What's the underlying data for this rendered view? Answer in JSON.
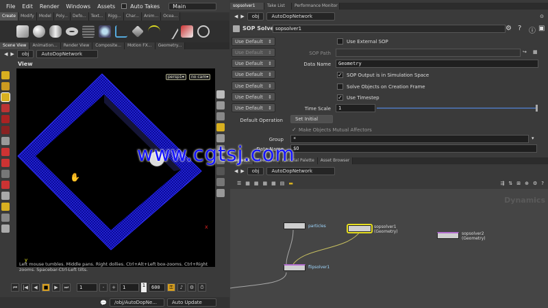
{
  "menu": {
    "items": [
      "File",
      "Edit",
      "Render",
      "Windows",
      "Assets"
    ],
    "auto_takes": "Auto Takes",
    "desktop": "Main"
  },
  "shelf_tabs": [
    "Create",
    "Modify",
    "Model",
    "Poly...",
    "Defo...",
    "Text...",
    "Rigg...",
    "Char...",
    "Anim...",
    "Ocea..."
  ],
  "left_tabs": [
    "Scene View",
    "Animation...",
    "Render View",
    "Composite...",
    "Motion FX...",
    "Geometry..."
  ],
  "left_path": {
    "context": "obj",
    "network": "AutoDopNetwork"
  },
  "viewport": {
    "title": "View",
    "camera": "persp1▾",
    "cam_menu": "no cam▾",
    "axis": "y",
    "status_line": "Left mouse tumbles. Middle pans. Right dollies. Ctrl+Alt+Left box-zooms. Ctrl+Right zooms. Spacebar-Ctrl-Left tilts."
  },
  "playbar": {
    "frame": "1",
    "start": "1",
    "current": "1",
    "end": "600",
    "plus": "+",
    "minus": "-"
  },
  "bottom": {
    "path": "/obj/AutoDopNe...",
    "update": "Auto Update"
  },
  "right_tabs": [
    "sopsolver1",
    "Take List",
    "Performance Monitor"
  ],
  "right_path": {
    "context": "obj",
    "network": "AutoDopNetwork"
  },
  "params": {
    "node_type": "SOP Solver",
    "node_name": "sopsolver1",
    "default_label": "Use Default",
    "use_external_sop": "Use External SOP",
    "sop_path_label": "SOP Path",
    "data_name_label": "Data Name",
    "data_name_value": "Geometry",
    "sop_output": "SOP Output is in Simulation Space",
    "solve_objects": "Solve Objects on Creation Frame",
    "use_timestep": "Use Timestep",
    "time_scale_label": "Time Scale",
    "time_scale_value": "1",
    "default_op_label": "Default Operation",
    "default_op_value": "Set Initial",
    "mutual": "Make Objects Mutual Affectors",
    "group_label": "Group",
    "group_value": "*",
    "data_name2_label": "Data Name",
    "data_name2_value": "$O"
  },
  "net_tabs": [
    "Network",
    "Tree View",
    "Material Palette",
    "Asset Browser"
  ],
  "net_path": {
    "context": "obj",
    "network": "AutoDopNetwork"
  },
  "network": {
    "context_label": "Dynamics",
    "nodes": [
      {
        "name": "particles",
        "sub": ""
      },
      {
        "name": "sopsolver1",
        "sub": "(Geometry)"
      },
      {
        "name": "sopsolver2",
        "sub": "(Geometry)"
      },
      {
        "name": "flipsolver1",
        "sub": ""
      }
    ]
  },
  "watermark": "www.cgtsj.com",
  "colors": {
    "wire": "#1a1aff",
    "accent": "#d8c020",
    "bg": "#3a3a3a"
  }
}
